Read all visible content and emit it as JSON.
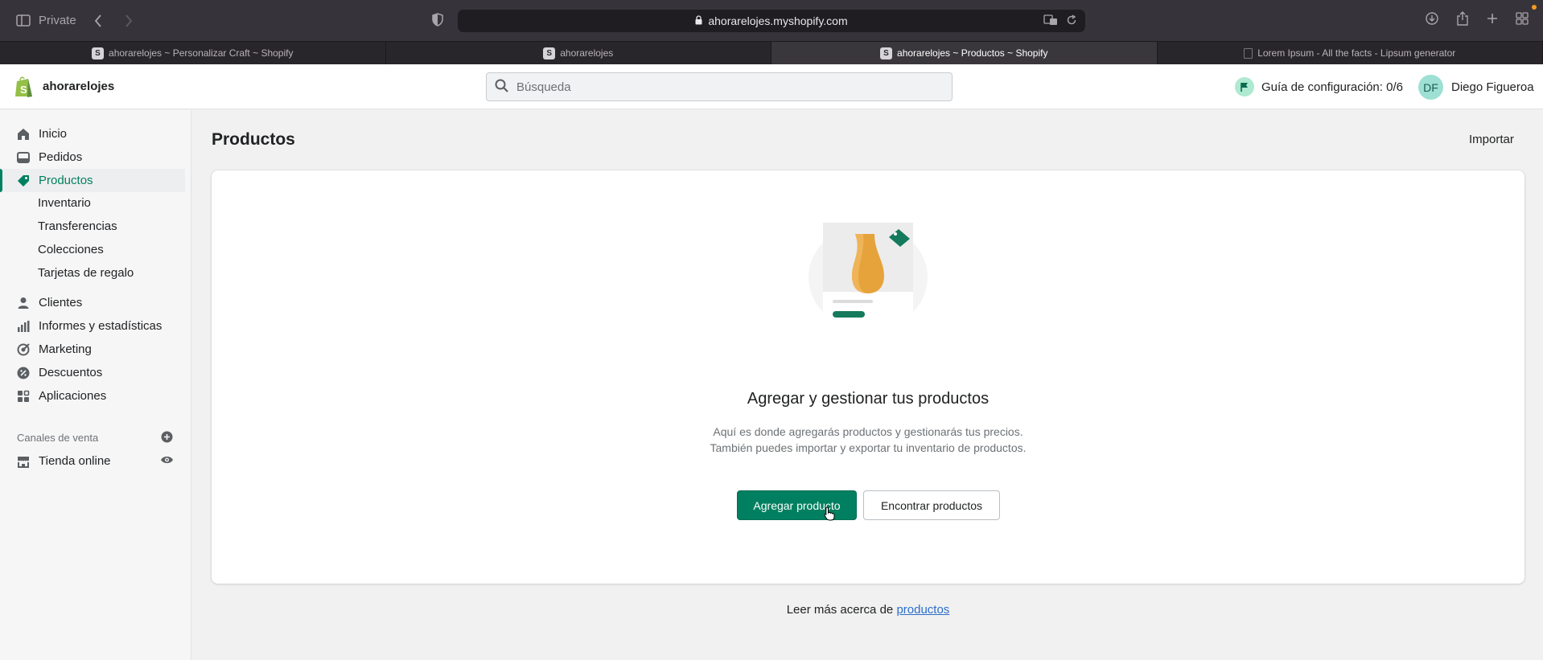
{
  "browser": {
    "mode_label": "Private",
    "url": "ahorarelojes.myshopify.com",
    "tabs": [
      {
        "label": "ahorarelojes ~ Personalizar Craft ~ Shopify",
        "active": false
      },
      {
        "label": "ahorarelojes",
        "active": false
      },
      {
        "label": "ahorarelojes ~ Productos ~ Shopify",
        "active": true
      },
      {
        "label": "Lorem Ipsum - All the facts - Lipsum generator",
        "active": false
      }
    ]
  },
  "topbar": {
    "store_name": "ahorarelojes",
    "search_placeholder": "Búsqueda",
    "setup_guide": "Guía de configuración: 0/6",
    "user_initials": "DF",
    "user_name": "Diego Figueroa"
  },
  "sidebar": {
    "items": [
      {
        "label": "Inicio",
        "icon": "home-icon"
      },
      {
        "label": "Pedidos",
        "icon": "orders-icon"
      },
      {
        "label": "Productos",
        "icon": "tag-icon",
        "active": true
      },
      {
        "label": "Clientes",
        "icon": "customer-icon"
      },
      {
        "label": "Informes y estadísticas",
        "icon": "analytics-icon"
      },
      {
        "label": "Marketing",
        "icon": "marketing-icon"
      },
      {
        "label": "Descuentos",
        "icon": "discount-icon"
      },
      {
        "label": "Aplicaciones",
        "icon": "apps-icon"
      }
    ],
    "sub_items": [
      "Inventario",
      "Transferencias",
      "Colecciones",
      "Tarjetas de regalo"
    ],
    "sales_channels_title": "Canales de venta",
    "channels": [
      {
        "label": "Tienda online",
        "icon": "store-icon"
      }
    ]
  },
  "main": {
    "title": "Productos",
    "import_label": "Importar",
    "empty_state": {
      "heading": "Agregar y gestionar tus productos",
      "description": "Aquí es donde agregarás productos y gestionarás tus precios. También puedes importar y exportar tu inventario de productos.",
      "primary_action": "Agregar producto",
      "secondary_action": "Encontrar productos"
    },
    "learn_more_prefix": "Leer más acerca de",
    "learn_more_link": "productos"
  },
  "colors": {
    "accent": "#008060",
    "sidebar_active_text": "#007f5f",
    "link": "#2c6ecb"
  }
}
